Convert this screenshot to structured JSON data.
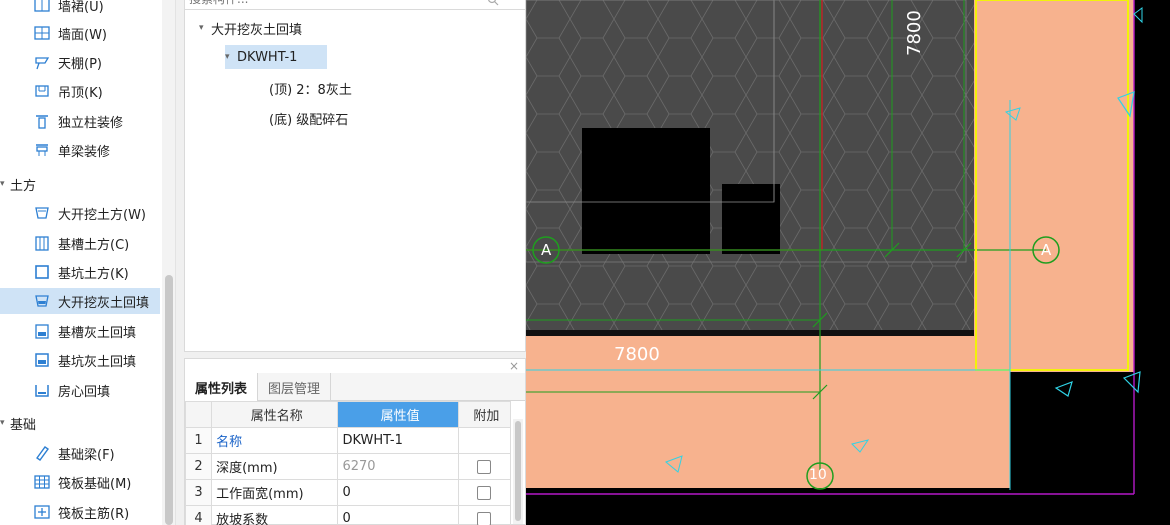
{
  "nav": {
    "items": [
      {
        "label": "墙裙(U)",
        "icon": "wainscot-icon"
      },
      {
        "label": "墙面(W)",
        "icon": "wall-surface-icon"
      },
      {
        "label": "天棚(P)",
        "icon": "ceiling-icon"
      },
      {
        "label": "吊顶(K)",
        "icon": "suspended-ceiling-icon"
      },
      {
        "label": "独立柱装修",
        "icon": "column-finish-icon"
      },
      {
        "label": "单梁装修",
        "icon": "beam-finish-icon"
      }
    ],
    "group_earthwork": "土方",
    "earthwork_items": [
      {
        "label": "大开挖土方(W)",
        "icon": "excavation-icon"
      },
      {
        "label": "基槽土方(C)",
        "icon": "trench-icon"
      },
      {
        "label": "基坑土方(K)",
        "icon": "pit-icon"
      },
      {
        "label": "大开挖灰土回填",
        "icon": "excavation-backfill-icon",
        "selected": true
      },
      {
        "label": "基槽灰土回填",
        "icon": "trench-backfill-icon"
      },
      {
        "label": "基坑灰土回填",
        "icon": "pit-backfill-icon"
      },
      {
        "label": "房心回填",
        "icon": "room-backfill-icon"
      }
    ],
    "group_foundation": "基础",
    "foundation_items": [
      {
        "label": "基础梁(F)",
        "icon": "foundation-beam-icon"
      },
      {
        "label": "筏板基础(M)",
        "icon": "raft-foundation-icon"
      },
      {
        "label": "筏板主筋(R)",
        "icon": "raft-rebar-icon"
      }
    ]
  },
  "search": {
    "placeholder": "搜索构件..."
  },
  "tree": {
    "root": "大开挖灰土回填",
    "child": "DKWHT-1",
    "leaf_top": "(顶) 2：8灰土",
    "leaf_bottom": "(底) 级配碎石"
  },
  "props": {
    "close": "×",
    "tabs": [
      "属性列表",
      "图层管理"
    ],
    "headers": {
      "name": "属性名称",
      "value": "属性值",
      "extra": "附加"
    },
    "rows": [
      {
        "num": "1",
        "name": "名称",
        "value": "DKWHT-1"
      },
      {
        "num": "2",
        "name": "深度(mm)",
        "value": "6270"
      },
      {
        "num": "3",
        "name": "工作面宽(mm)",
        "value": "0"
      },
      {
        "num": "4",
        "name": "放坡系数",
        "value": "0"
      }
    ]
  },
  "cad": {
    "dim_vertical": "7800",
    "dim_horizontal": "7800",
    "axis_a": "A",
    "axis_10": "10",
    "colors": {
      "background": "#000000",
      "hatch_fill": "#4a4a4a",
      "backfill": "#f7b28e",
      "axis_green": "#1f9e1f",
      "red_line": "#d21f1f",
      "yellow_line": "#f2f20a",
      "cyan_line": "#2fd3e6",
      "magenta_line": "#b419c8"
    }
  }
}
